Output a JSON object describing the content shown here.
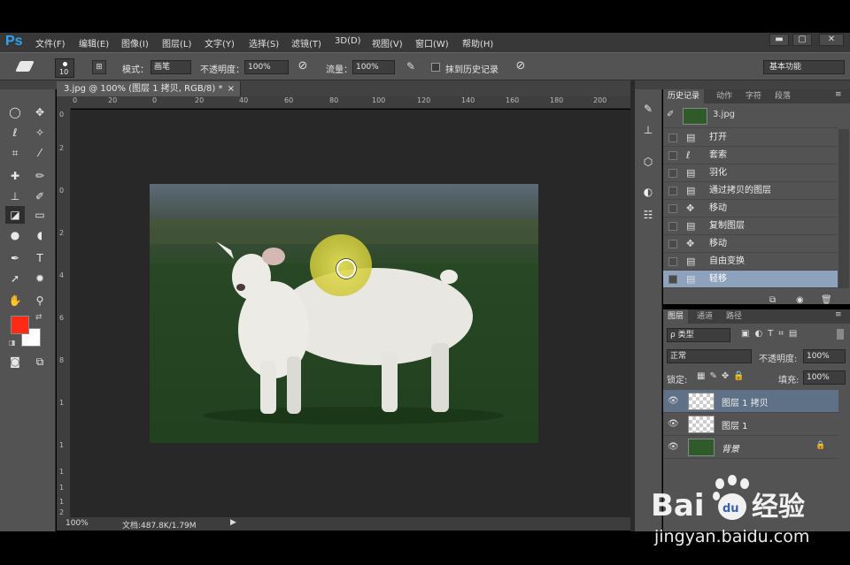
{
  "app": {
    "logo": "Ps"
  },
  "menu": [
    "文件(F)",
    "编辑(E)",
    "图像(I)",
    "图层(L)",
    "文字(Y)",
    "选择(S)",
    "滤镜(T)",
    "3D(D)",
    "视图(V)",
    "窗口(W)",
    "帮助(H)"
  ],
  "window_buttons": {
    "minimize": "▬",
    "restore": "▢",
    "close": "✕"
  },
  "options": {
    "brush_size": "10",
    "mode_label": "模式：",
    "mode_value": "画笔",
    "opacity_label": "不透明度：",
    "opacity_value": "100%",
    "flow_label": "流量：",
    "flow_value": "100%",
    "erase_history_label": "抹到历史记录",
    "workspace": "基本功能"
  },
  "document": {
    "tab_title": "3.jpg @ 100% (图层 1 拷贝, RGB/8) *",
    "zoom": "100%",
    "doc_info": "文档:487.8K/1.79M",
    "ruler_h": [
      "0",
      "20",
      "0",
      "20",
      "40",
      "60",
      "80",
      "100",
      "120",
      "140",
      "160",
      "180",
      "200"
    ],
    "ruler_v": [
      "0",
      "2",
      "0",
      "2",
      "4",
      "6",
      "8",
      "1",
      "1",
      "1",
      "1",
      "1",
      "2"
    ]
  },
  "history_panel": {
    "tabs": [
      "历史记录",
      "动作",
      "字符",
      "段落"
    ],
    "snapshot": "3.jpg",
    "items": [
      "打开",
      "套索",
      "羽化",
      "通过拷贝的图层",
      "移动",
      "复制图层",
      "移动",
      "自由变换",
      "轻移"
    ]
  },
  "layers_panel": {
    "tabs": [
      "图层",
      "通道",
      "路径"
    ],
    "filter": "ρ 类型",
    "blend_mode": "正常",
    "opacity_label": "不透明度:",
    "opacity_value": "100%",
    "lock_label": "锁定:",
    "fill_label": "填充:",
    "fill_value": "100%",
    "layers": [
      {
        "name": "图层 1 拷贝",
        "selected": true
      },
      {
        "name": "图层 1",
        "selected": false
      },
      {
        "name": "背景",
        "selected": false
      }
    ]
  },
  "colors": {
    "foreground": "#ff2a14",
    "background": "#ffffff",
    "ps_blue": "#2fa3f5",
    "selection_blue": "#8ea2bd"
  },
  "watermark": {
    "brand": "Bai",
    "paw": "du",
    "product": "经验",
    "url": "jingyan.baidu.com"
  }
}
